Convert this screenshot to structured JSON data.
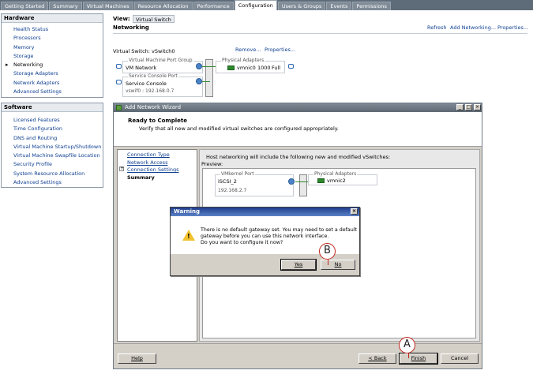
{
  "tabs": [
    {
      "label": "Getting Started"
    },
    {
      "label": "Summary"
    },
    {
      "label": "Virtual Machines"
    },
    {
      "label": "Resource Allocation"
    },
    {
      "label": "Performance"
    },
    {
      "label": "Configuration",
      "active": true
    },
    {
      "label": "Users & Groups"
    },
    {
      "label": "Events"
    },
    {
      "label": "Permissions"
    }
  ],
  "hardware": {
    "title": "Hardware",
    "items": [
      "Health Status",
      "Processors",
      "Memory",
      "Storage",
      "Networking",
      "Storage Adapters",
      "Network Adapters",
      "Advanced Settings"
    ],
    "current": "Networking"
  },
  "software": {
    "title": "Software",
    "items": [
      "Licensed Features",
      "Time Configuration",
      "DNS and Routing",
      "Virtual Machine Startup/Shutdown",
      "Virtual Machine Swapfile Location",
      "Security Profile",
      "System Resource Allocation",
      "Advanced Settings"
    ]
  },
  "main": {
    "view_label": "View:",
    "view_value": "Virtual Switch",
    "section_title": "Networking",
    "refresh": "Refresh",
    "add_networking": "Add Networking...",
    "properties": "Properties...",
    "vswitch_label": "Virtual Switch: vSwitch0",
    "remove": "Remove...",
    "vswitch_properties": "Properties...",
    "vm_pg_group": "Virtual Machine Port Group",
    "vm_network": "VM Network",
    "sc_port": "Service Console Port",
    "service_console": "Service Console",
    "vswif": "vswif0 : 192.168.0.7",
    "physical_adapters": "Physical Adapters",
    "nic_name": "vmnic0",
    "nic_speed": "1000",
    "nic_duplex": "Full"
  },
  "wizard": {
    "title": "Add Network Wizard",
    "heading": "Ready to Complete",
    "subheading": "Verify that all new and modified virtual switches are configured appropriately.",
    "nav": [
      "Connection Type",
      "Network Access",
      "Connection Settings",
      "Summary"
    ],
    "info": "Host networking will include the following new and modified vSwitches:",
    "preview_label": "Preview:",
    "vmkernel_port": "VMkernel Port",
    "port_name": "iSCSI_2",
    "port_ip": "192.168.2.7",
    "physical_adapters": "Physical Adapters",
    "nic_name": "vmnic2",
    "help": "Help",
    "back": "< Back",
    "finish": "Finish",
    "cancel": "Cancel"
  },
  "warning": {
    "title": "Warning",
    "message_line1": "There is no default gateway set. You may need to set a default",
    "message_line2": "gateway before you can use this network interface.",
    "message_line3": "Do you want to configure it now?",
    "yes": "Yes",
    "no": "No"
  },
  "callouts": {
    "a": "A",
    "b": "B"
  },
  "colors": {
    "link": "#0d3f91",
    "callout": "#c0261c",
    "nic": "#2c8a2c"
  }
}
